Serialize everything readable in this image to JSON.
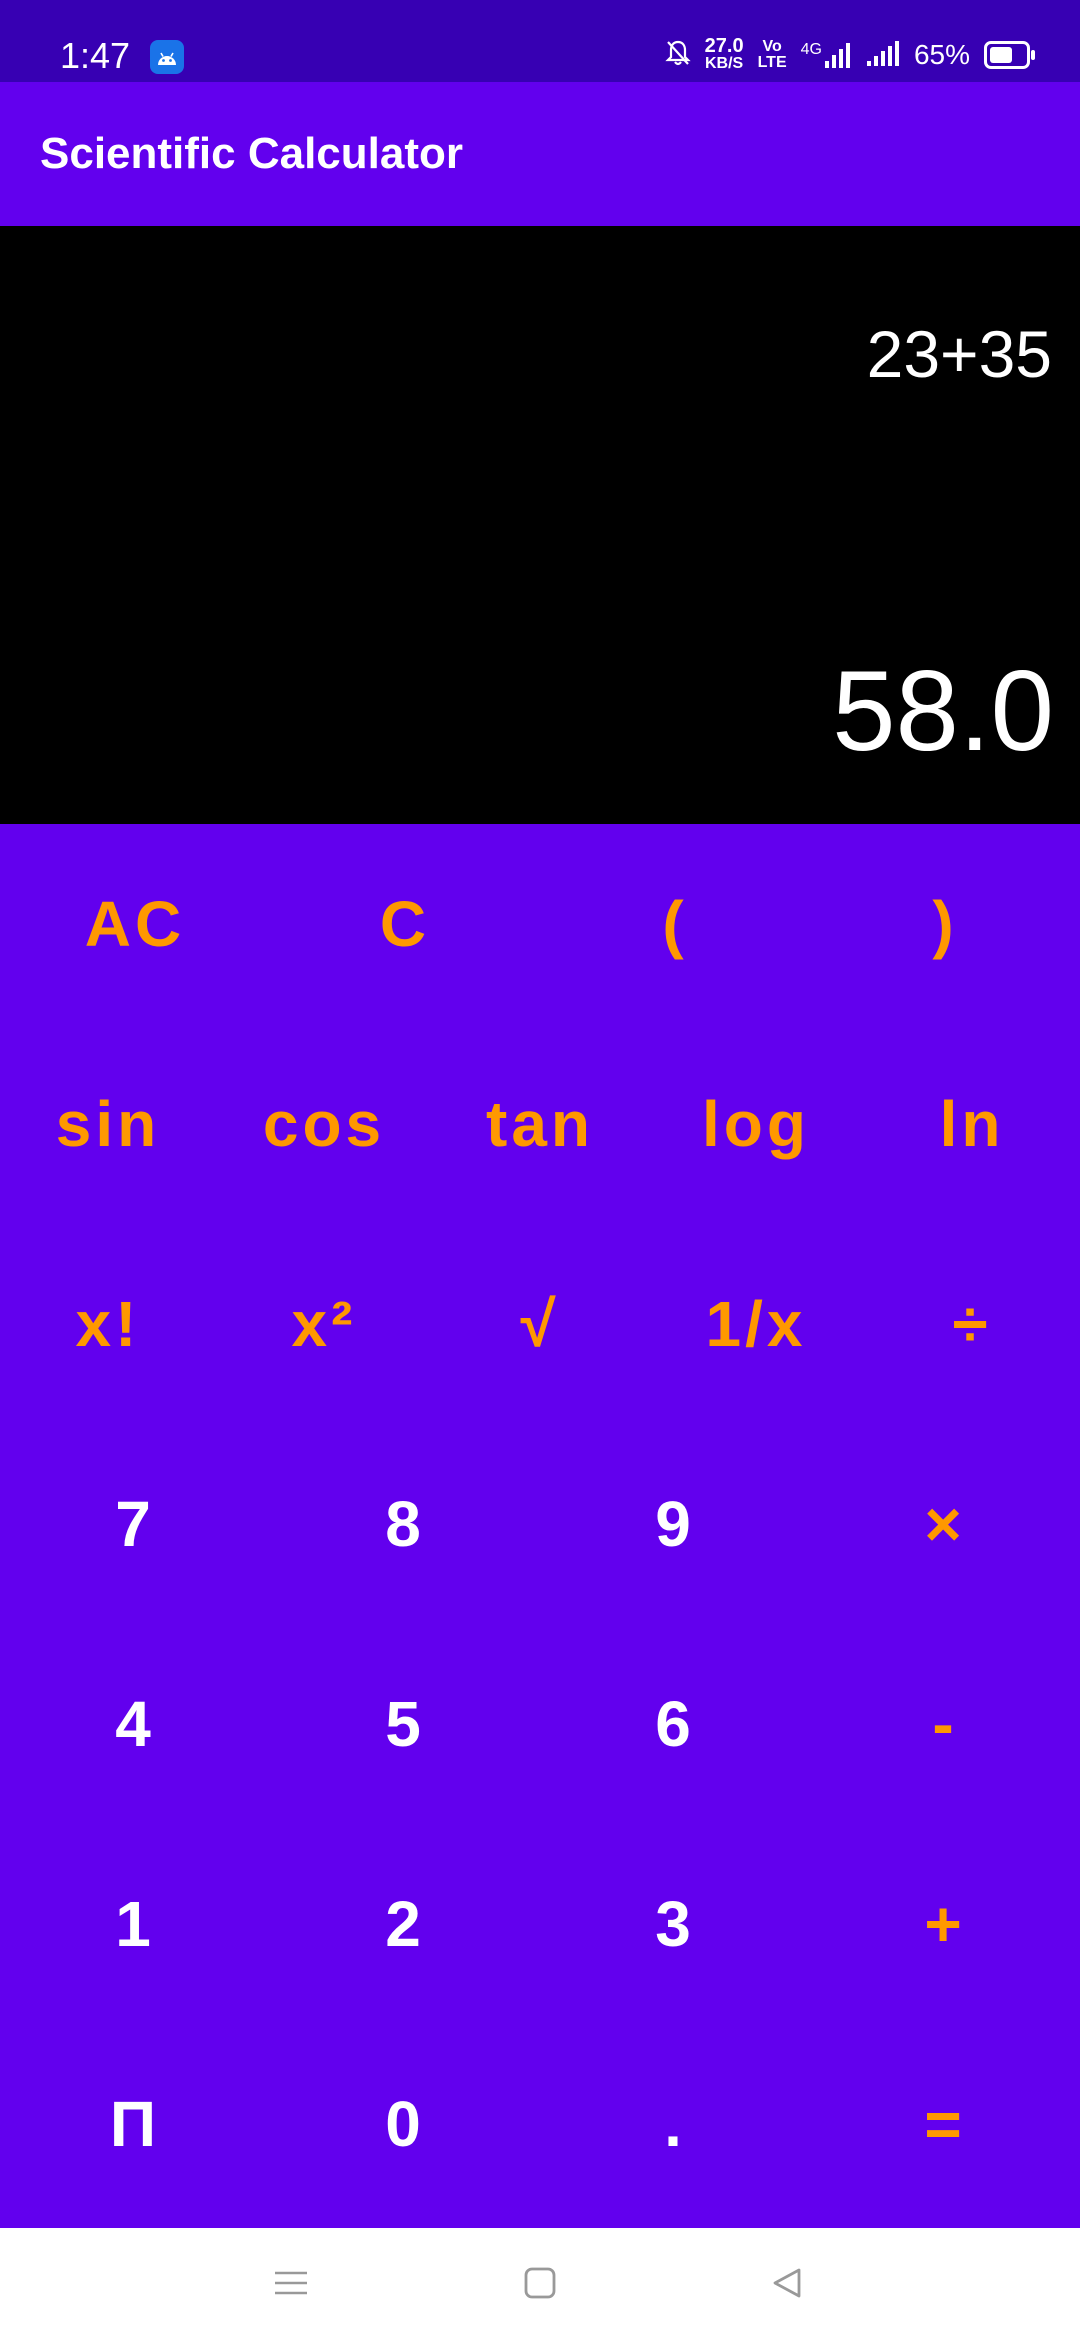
{
  "status": {
    "time": "1:47",
    "net_speed_value": "27.0",
    "net_speed_unit": "KB/S",
    "volte_top": "Vo",
    "volte_bottom": "LTE",
    "network": "4G",
    "battery_percent": "65%",
    "battery_level": 0.65
  },
  "app": {
    "title": "Scientific Calculator"
  },
  "display": {
    "expression": "23+35",
    "result": "58.0"
  },
  "keypad": {
    "rows": [
      [
        "AC",
        "C",
        "(",
        ")"
      ],
      [
        "sin",
        "cos",
        "tan",
        "log",
        "ln"
      ],
      [
        "x!",
        "x²",
        "√",
        "1/x",
        "÷"
      ],
      [
        "7",
        "8",
        "9",
        "×"
      ],
      [
        "4",
        "5",
        "6",
        "-"
      ],
      [
        "1",
        "2",
        "3",
        "+"
      ],
      [
        "Π",
        "0",
        ".",
        "="
      ]
    ]
  },
  "colors": {
    "primary": "#6200ee",
    "primary_dark": "#3700b3",
    "accent_orange": "#ff9800",
    "display_bg": "#000000"
  },
  "icons": {
    "status_app": "android-icon",
    "mute": "bell-off-icon",
    "nav_menu": "menu-icon",
    "nav_home": "home-square-icon",
    "nav_back": "back-triangle-icon"
  }
}
